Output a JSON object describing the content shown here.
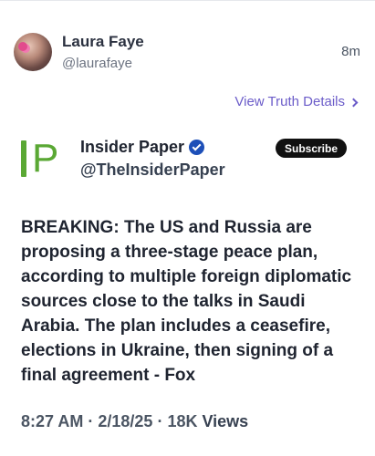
{
  "post": {
    "author_name": "Laura Faye",
    "author_handle": "@laurafaye",
    "time": "8m",
    "details_link": "View Truth Details"
  },
  "embed": {
    "logo_letters": "P",
    "name": "Insider Paper",
    "handle": "@TheInsiderPaper",
    "subscribe_label": "Subscribe",
    "text": "BREAKING: The US and Russia are proposing a three-stage peace plan, according to multiple foreign diplomatic sources close to the talks in Saudi Arabia. The plan includes a ceasefire, elections in Ukraine, then signing of a final agreement - Fox",
    "time": "8:27 AM",
    "date": "2/18/25",
    "views_count": "18K",
    "views_label": "Views"
  },
  "colors": {
    "link": "#6b5cc9",
    "logo_green": "#5aa834",
    "verified_blue": "#1d4fb8"
  },
  "icons": {
    "verified": "verified-badge-icon",
    "chevron": "chevron-right-icon"
  }
}
